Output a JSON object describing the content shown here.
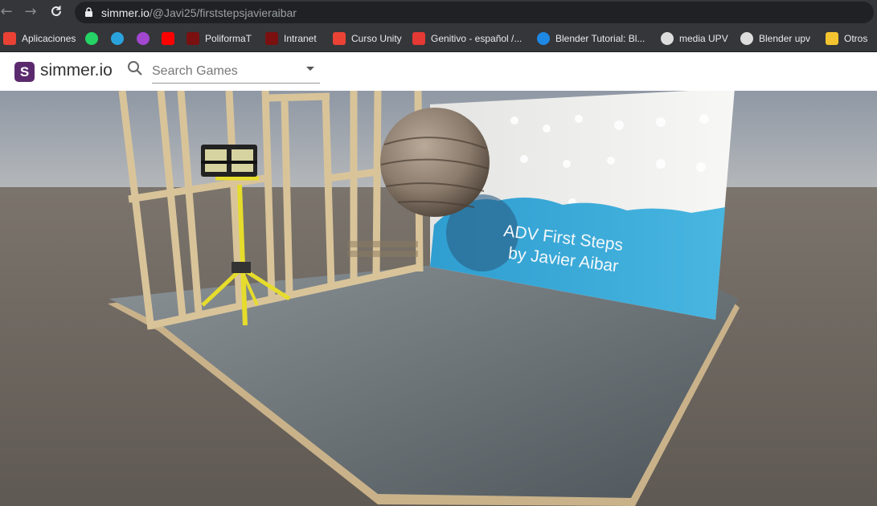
{
  "browser": {
    "url_host": "simmer.io",
    "url_path": "/@Javi25/firststepsjavieraibar",
    "bookmarks": [
      {
        "label": "Aplicaciones",
        "icon": "apps-grid-icon",
        "color": "#e94235"
      },
      {
        "label": "",
        "icon": "whatsapp-icon",
        "color": "#25d366"
      },
      {
        "label": "",
        "icon": "telegram-icon",
        "color": "#2aa3dd"
      },
      {
        "label": "",
        "icon": "podcast-icon",
        "color": "#a347d1"
      },
      {
        "label": "",
        "icon": "youtube-icon",
        "color": "#ff0000"
      },
      {
        "label": "PoliformaT",
        "icon": "upv-icon",
        "color": "#7a1010"
      },
      {
        "label": "Intranet",
        "icon": "upv-icon",
        "color": "#7a1010"
      },
      {
        "label": "Curso Unity",
        "icon": "gmail-icon",
        "color": "#ea4335"
      },
      {
        "label": "Genitivo - español /...",
        "icon": "fifty-icon",
        "color": "#e53935"
      },
      {
        "label": "Blender Tutorial: Bl...",
        "icon": "blender-icon",
        "color": "#1e88e5"
      },
      {
        "label": "media UPV",
        "icon": "globe-icon",
        "color": "#dddddd"
      },
      {
        "label": "Blender upv",
        "icon": "globe-icon",
        "color": "#dddddd"
      },
      {
        "label": "Otros",
        "icon": "folder-icon",
        "color": "#f4c430"
      }
    ]
  },
  "simmer": {
    "logo_letter": "S",
    "brand": "simmer.io",
    "search_placeholder": "Search Games"
  },
  "scene": {
    "line1": "ADV First Steps",
    "line2": "by Javier Aibar"
  }
}
